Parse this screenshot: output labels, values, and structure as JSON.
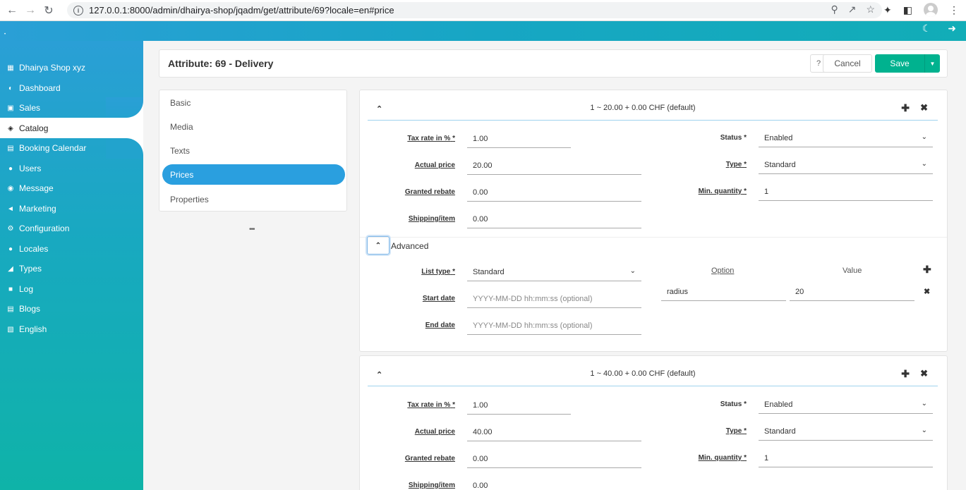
{
  "browser": {
    "url": "127.0.0.1:8000/admin/dhairya-shop/jqadm/get/attribute/69?locale=en#price"
  },
  "sidebar": {
    "items": [
      {
        "label": "Dhairya Shop xyz",
        "icon": "store-icon"
      },
      {
        "label": "Dashboard",
        "icon": "dashboard-icon"
      },
      {
        "label": "Sales",
        "icon": "money-icon"
      },
      {
        "label": "Catalog",
        "icon": "sitemap-icon"
      },
      {
        "label": "Booking Calendar",
        "icon": "calendar-icon"
      },
      {
        "label": "Users",
        "icon": "users-icon"
      },
      {
        "label": "Message",
        "icon": "comments-icon"
      },
      {
        "label": "Marketing",
        "icon": "bullhorn-icon"
      },
      {
        "label": "Configuration",
        "icon": "cogs-icon"
      },
      {
        "label": "Locales",
        "icon": "globe-icon"
      },
      {
        "label": "Types",
        "icon": "tag-icon"
      },
      {
        "label": "Log",
        "icon": "book-icon"
      },
      {
        "label": "Blogs",
        "icon": "newspaper-icon"
      },
      {
        "label": "English",
        "icon": "language-icon"
      }
    ]
  },
  "page": {
    "title": "Attribute: 69 - Delivery",
    "help_label": "?",
    "cancel_label": "Cancel",
    "save_label": "Save"
  },
  "tabs": [
    "Basic",
    "Media",
    "Texts",
    "Prices",
    "Properties"
  ],
  "active_tab": "Prices",
  "more_label": "•••",
  "labels": {
    "tax_rate": "Tax rate in %",
    "actual_price": "Actual price",
    "granted_rebate": "Granted rebate",
    "shipping": "Shipping/item",
    "status": "Status",
    "type": "Type",
    "min_quantity": "Min. quantity",
    "required": "*",
    "advanced": "Advanced",
    "list_type": "List type",
    "start_date": "Start date",
    "end_date": "End date",
    "option": "Option",
    "value": "Value"
  },
  "prices": [
    {
      "title": "1 ~ 20.00 + 0.00 CHF (default)",
      "tax_rate": "1.00",
      "actual_price": "20.00",
      "granted_rebate": "0.00",
      "shipping": "0.00",
      "status": "Enabled",
      "type": "Standard",
      "min_quantity": "1",
      "advanced": {
        "list_type": "Standard",
        "start_placeholder": "YYYY-MM-DD hh:mm:ss (optional)",
        "end_placeholder": "YYYY-MM-DD hh:mm:ss (optional)",
        "option_key": "radius",
        "option_value": "20"
      }
    },
    {
      "title": "1 ~ 40.00 + 0.00 CHF (default)",
      "tax_rate": "1.00",
      "actual_price": "40.00",
      "granted_rebate": "0.00",
      "shipping": "0.00",
      "status": "Enabled",
      "type": "Standard",
      "min_quantity": "1"
    }
  ],
  "colors": {
    "accent": "#2a9fdf",
    "save": "#00b28f"
  }
}
